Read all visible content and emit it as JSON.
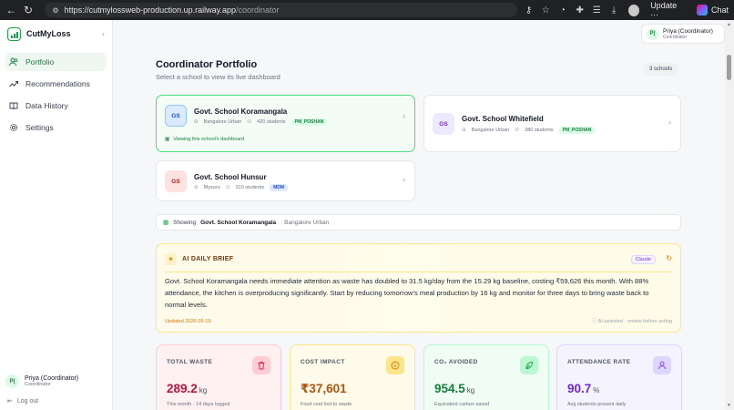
{
  "browser": {
    "url_host": "https://cutmylossweb-production.up.railway.app",
    "url_path": "/coordinator",
    "update_label": "Update",
    "chat_label": "Chat"
  },
  "sidebar": {
    "brand": "CutMyLoss",
    "items": [
      {
        "label": "Portfolio",
        "icon": "user-group-icon",
        "active": true
      },
      {
        "label": "Recommendations",
        "icon": "trend-icon",
        "active": false
      },
      {
        "label": "Data History",
        "icon": "book-icon",
        "active": false
      },
      {
        "label": "Settings",
        "icon": "gear-icon",
        "active": false
      }
    ],
    "user": {
      "initials": "P(",
      "name": "Priya (Coordinator)",
      "role": "Coordinator"
    },
    "logout_label": "Log out"
  },
  "header_user": {
    "initials": "P(",
    "name": "Priya (Coordinator)",
    "role": "Coordinator"
  },
  "portfolio": {
    "title": "Coordinator Portfolio",
    "subtitle": "Select a school to view its live dashboard",
    "count_label": "3 schools"
  },
  "schools": [
    {
      "initials": "GS",
      "name": "Govt. School Koramangala",
      "location": "Bangalore Urban",
      "students": "420 students",
      "program": "PM_POSHAN",
      "selected": true,
      "viewing_label": "Viewing this school's dashboard",
      "badge_bg": "#dbeafe",
      "badge_fg": "#1d4ed8"
    },
    {
      "initials": "GS",
      "name": "Govt. School Whitefield",
      "location": "Bangalore Urban",
      "students": "380 students",
      "program": "PM_POSHAN",
      "selected": false,
      "badge_bg": "#ede9fe",
      "badge_fg": "#6d28d9"
    },
    {
      "initials": "GS",
      "name": "Govt. School Hunsur",
      "location": "Mysuru",
      "students": "310 students",
      "program": "MDM",
      "selected": false,
      "badge_bg": "#fee2e2",
      "badge_fg": "#b91c1c"
    }
  ],
  "showing": {
    "prefix": "Showing",
    "school": "Govt. School Koramangala",
    "region": "· Bangalore Urban"
  },
  "brief": {
    "title": "AI DAILY BRIEF",
    "model_badge": "Claude",
    "text": "Govt. School Koramangala needs immediate attention as waste has doubled to 31.5 kg/day from the 15.29 kg baseline, costing ₹59,626 this month. With 88% attendance, the kitchen is overproducing significantly. Start by reducing tomorrow's meal production by 16 kg and monitor for three days to bring waste back to normal levels.",
    "updated": "Updated 2026-05-19",
    "note": "AI-assisted · review before acting"
  },
  "stats": [
    {
      "label": "TOTAL WASTE",
      "value": "289.2",
      "unit": "kg",
      "foot": "This month · 14 days logged",
      "icon": "trash-icon",
      "bg": "#fff1f2",
      "border": "#fecdd3",
      "value_color": "#be123c",
      "icon_bg": "#fecdd3",
      "icon_fg": "#e11d48"
    },
    {
      "label": "COST IMPACT",
      "value": "₹37,601",
      "unit": "",
      "foot": "Food cost lost to waste",
      "icon": "coin-icon",
      "bg": "#fffbeb",
      "border": "#fde68a",
      "value_color": "#b45309",
      "icon_bg": "#fde68a",
      "icon_fg": "#d97706"
    },
    {
      "label": "CO₂ AVOIDED",
      "value": "954.5",
      "unit": "kg",
      "foot": "Equivalent carbon saved",
      "icon": "leaf-icon",
      "bg": "#f0fdf4",
      "border": "#bbf7d0",
      "value_color": "#15803d",
      "icon_bg": "#bbf7d0",
      "icon_fg": "#16a34a"
    },
    {
      "label": "ATTENDANCE RATE",
      "value": "90.7",
      "unit": "%",
      "foot": "Avg students present daily",
      "icon": "person-icon",
      "bg": "#f5f3ff",
      "border": "#ddd6fe",
      "value_color": "#6d28d9",
      "icon_bg": "#ddd6fe",
      "icon_fg": "#7c3aed"
    }
  ]
}
